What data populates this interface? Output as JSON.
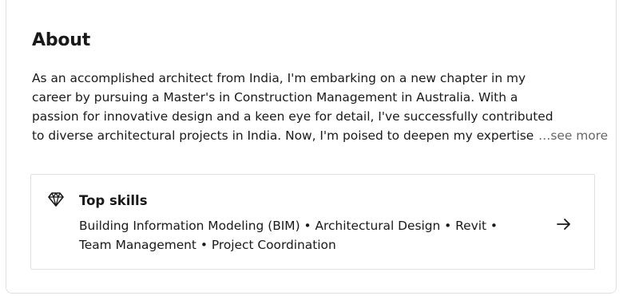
{
  "about": {
    "title": "About",
    "lines": [
      "As an accomplished architect from India, I'm embarking on a new chapter in my",
      "career by pursuing a Master's in Construction Management in Australia. With a",
      "passion for innovative design and a keen eye for detail, I've successfully contributed",
      "to diverse architectural projects in India. Now, I'm poised to deepen my expertise"
    ],
    "see_more": "…see more"
  },
  "top_skills": {
    "icon": "gem-icon",
    "title": "Top skills",
    "line1": "Building Information Modeling (BIM) • Architectural Design • Revit •",
    "line2": "Team Management • Project Coordination",
    "arrow_icon": "arrow-right-icon"
  },
  "colors": {
    "text": "#191919",
    "muted": "#666666",
    "border": "#e0e0e0"
  }
}
